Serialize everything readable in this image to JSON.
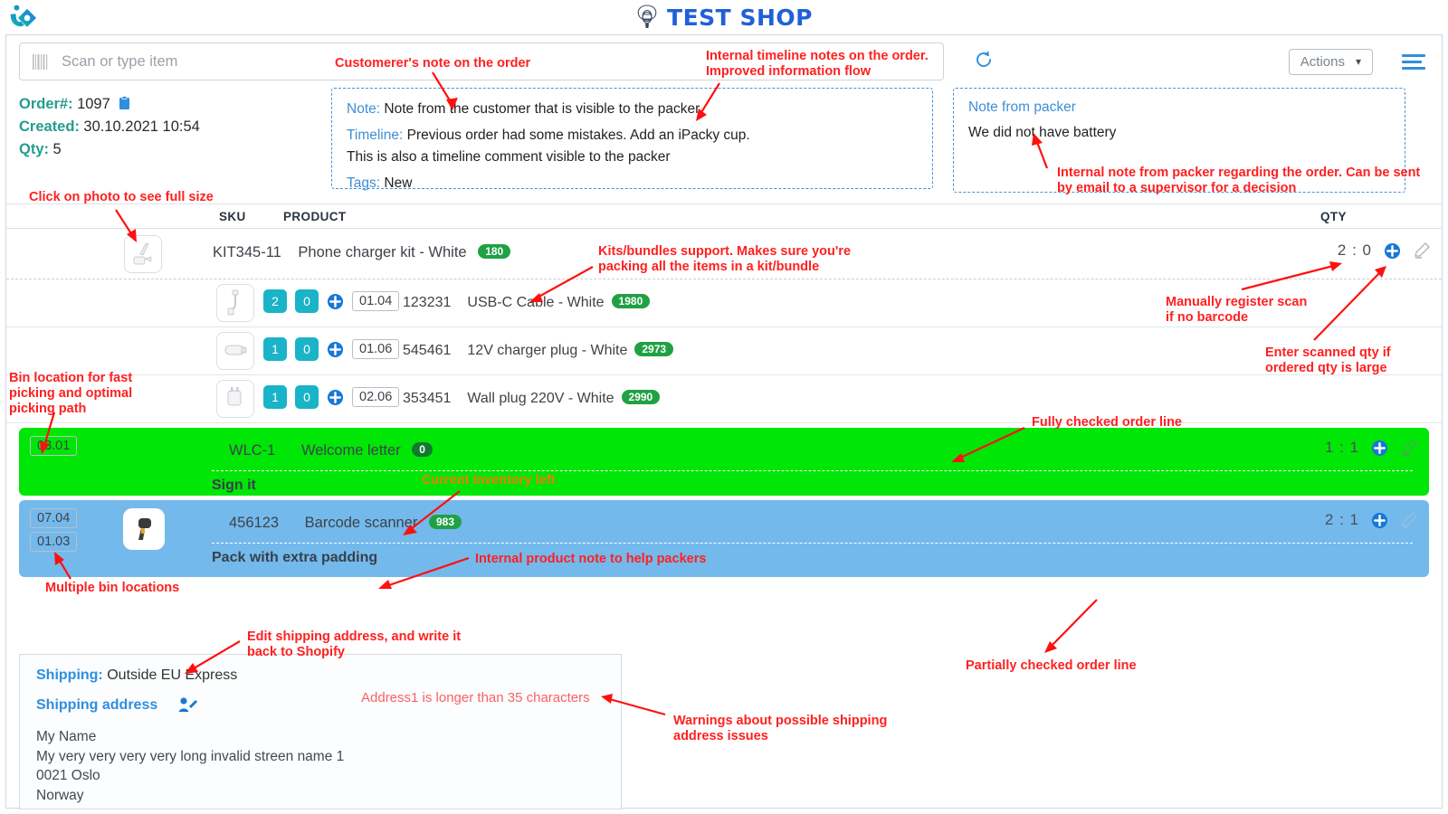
{
  "header": {
    "shop_name": "TEST SHOP",
    "logo_icon": "ipacky-logo-icon",
    "shop_icon": "globe-balloon-icon"
  },
  "toolbar": {
    "scan_placeholder": "Scan or type item",
    "barcode_icon": "barcode-icon",
    "refresh_icon": "refresh-icon",
    "actions_label": "Actions",
    "chevron_icon": "chevron-down-icon",
    "menu_icon": "hamburger-menu-icon"
  },
  "order": {
    "number_label": "Order#:",
    "number_value": "1097",
    "clipboard_icon": "clipboard-icon",
    "created_label": "Created:",
    "created_value": "30.10.2021 10:54",
    "qty_label": "Qty:",
    "qty_value": "5"
  },
  "order_note": {
    "note_label": "Note:",
    "note_value": "Note from the customer that is visible to the packer",
    "timeline_label": "Timeline:",
    "timeline_value": "Previous order had some mistakes. Add an iPacky cup.",
    "timeline_value2": "This is also a timeline comment visible to the packer",
    "tags_label": "Tags:",
    "tags_value": "New"
  },
  "packer_note": {
    "title": "Note from packer",
    "body": "We did not have battery"
  },
  "table": {
    "columns": {
      "sku": "SKU",
      "product": "PRODUCT",
      "qty": "QTY"
    },
    "kit": {
      "thumb_icon": "charger-kit-photo",
      "sku": "KIT345-11",
      "name": "Phone charger kit - White",
      "inventory": "180",
      "qty": "2 : 0",
      "plus_icon": "plus-circle-icon",
      "edit_icon": "pencil-icon"
    },
    "kit_items": [
      {
        "thumb_icon": "usb-cable-photo",
        "scanned": "2",
        "remaining": "0",
        "plus_icon": "plus-circle-icon",
        "bin": "01.04",
        "sku": "123231",
        "name": "USB-C Cable - White",
        "inventory": "1980"
      },
      {
        "thumb_icon": "car-charger-photo",
        "scanned": "1",
        "remaining": "0",
        "plus_icon": "plus-circle-icon",
        "bin": "01.06",
        "sku": "545461",
        "name": "12V charger plug - White",
        "inventory": "2973"
      },
      {
        "thumb_icon": "wall-plug-photo",
        "scanned": "1",
        "remaining": "0",
        "plus_icon": "plus-circle-icon",
        "bin": "02.06",
        "sku": "353451",
        "name": "Wall plug 220V - White",
        "inventory": "2990"
      }
    ],
    "full_row": {
      "bins": [
        "03.01"
      ],
      "sku": "WLC-1",
      "name": "Welcome letter",
      "inventory": "0",
      "note": "Sign it",
      "qty": "1 : 1",
      "plus_icon": "plus-circle-icon",
      "edit_icon": "pencil-icon"
    },
    "partial_row": {
      "bins": [
        "07.04",
        "01.03"
      ],
      "thumb_icon": "barcode-scanner-photo",
      "sku": "456123",
      "name": "Barcode scanner",
      "inventory": "983",
      "note": "Pack with extra padding",
      "qty": "2 : 1",
      "plus_icon": "plus-circle-icon",
      "edit_icon": "pencil-icon"
    }
  },
  "shipping": {
    "method_label": "Shipping:",
    "method_value": "Outside EU Express",
    "address_title": "Shipping address",
    "edit_icon": "edit-contact-icon",
    "line1": "My Name",
    "line2": "My very very very very long invalid streen name 1",
    "line3": "0021  Oslo",
    "line4": "Norway"
  },
  "annotations": {
    "customer_note": "Customerer's note on the order",
    "timeline_note": "Internal timeline notes on the order.\nImproved information flow",
    "packer_note": "Internal note from packer regarding the order. Can be sent\nby email to a supervisor for a decision",
    "click_photo": "Click on photo to see full size",
    "kits_bundles": "Kits/bundles support. Makes sure you're\npacking all the items in a kit/bundle",
    "manual_scan": "Manually register scan\nif no barcode",
    "enter_qty": "Enter scanned qty if\nordered qty is large",
    "bin_location": "Bin location for fast\npicking and optimal\npicking path",
    "fully_checked": "Fully checked order line",
    "current_inventory": "Current inventory left",
    "multiple_bins": "Multiple bin locations",
    "product_note": "Internal product note to help packers",
    "partially_checked": "Partially checked order line",
    "edit_shipping": "Edit shipping address, and write it\nback to Shopify",
    "address_warning": "Address1 is longer than 35 characters",
    "shipping_warnings": "Warnings about possible shipping\naddress issues"
  },
  "colors": {
    "brand_blue": "#2160d8",
    "accent_blue": "#2f8ede",
    "teal": "#1ab3c8",
    "green_row": "#00e606",
    "blue_row": "#74b9ec",
    "badge_green": "#20a144",
    "annotation_red": "#ff2020"
  }
}
